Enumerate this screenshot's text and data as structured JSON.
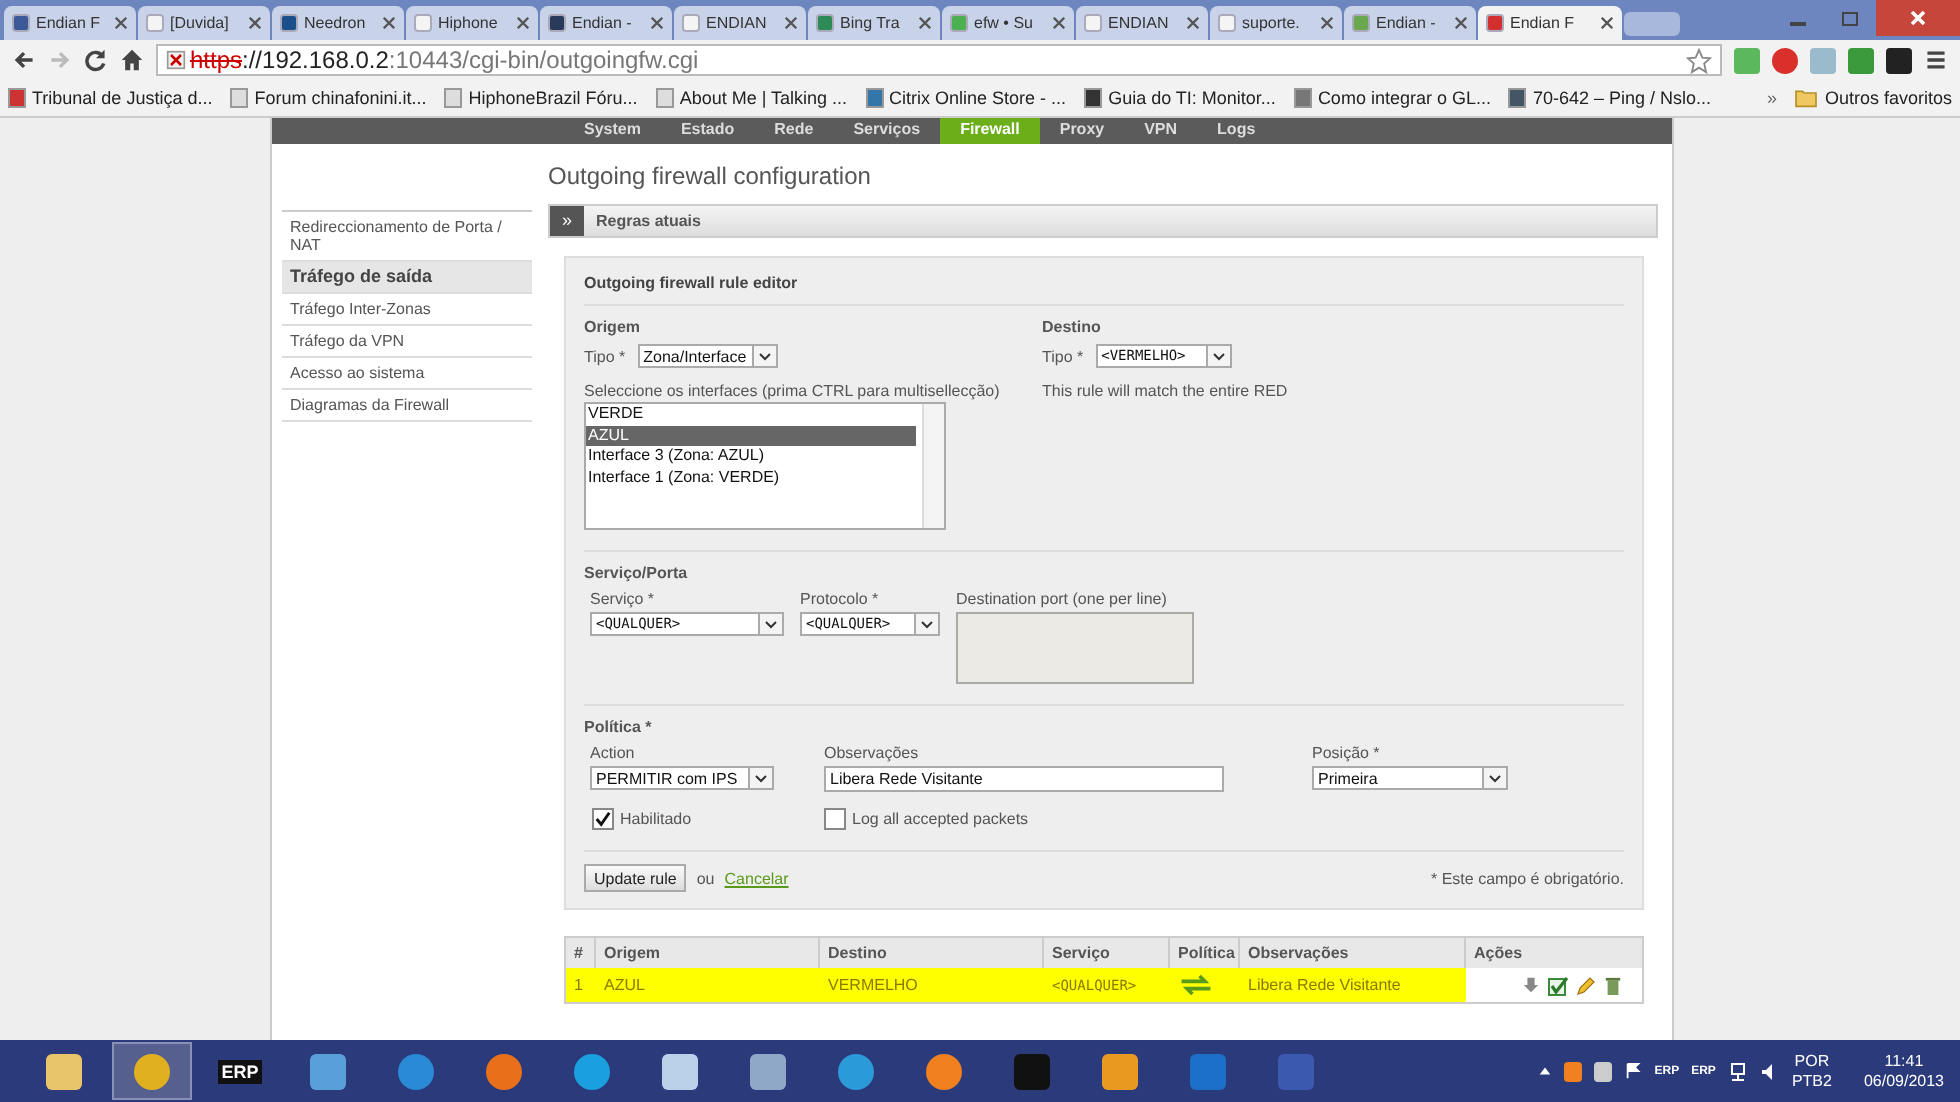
{
  "browser": {
    "tabs": [
      {
        "title": "Endian F",
        "kind": "facebook",
        "selected": false
      },
      {
        "title": "[Duvida]",
        "kind": "page",
        "selected": false
      },
      {
        "title": "Needron",
        "kind": "arch",
        "selected": false
      },
      {
        "title": "Hiphone",
        "kind": "page",
        "selected": false
      },
      {
        "title": "Endian -",
        "kind": "e",
        "selected": false
      },
      {
        "title": "ENDIAN",
        "kind": "page",
        "selected": false
      },
      {
        "title": "Bing Tra",
        "kind": "bing",
        "selected": false
      },
      {
        "title": "efw • Su",
        "kind": "green",
        "selected": false
      },
      {
        "title": "ENDIAN",
        "kind": "page",
        "selected": false
      },
      {
        "title": "suporte.",
        "kind": "page",
        "selected": false
      },
      {
        "title": "Endian -",
        "kind": "leaf",
        "selected": false
      },
      {
        "title": "Endian F",
        "kind": "stop",
        "selected": true
      }
    ],
    "url": {
      "scheme": "https",
      "host": "://192.168.0.2",
      "rest": ":10443/cgi-bin/outgoingfw.cgi"
    },
    "bookmarks": [
      {
        "title": "Tribunal de Justiça d...",
        "kind": "triangle"
      },
      {
        "title": "Forum chinafonini.it...",
        "kind": "page"
      },
      {
        "title": "HiphoneBrazil Fóru...",
        "kind": "page"
      },
      {
        "title": "About Me | Talking ...",
        "kind": "page"
      },
      {
        "title": "Citrix Online Store - ...",
        "kind": "dots"
      },
      {
        "title": "Guia do TI: Monitor...",
        "kind": "person"
      },
      {
        "title": "Como integrar o GL...",
        "kind": "gear"
      },
      {
        "title": "70-642 – Ping / Nslo...",
        "kind": "wp"
      }
    ],
    "overflow": "»",
    "other_bookmarks": "Outros favoritos"
  },
  "nav": [
    {
      "label": "System",
      "selected": false
    },
    {
      "label": "Estado",
      "selected": false
    },
    {
      "label": "Rede",
      "selected": false
    },
    {
      "label": "Serviços",
      "selected": false
    },
    {
      "label": "Firewall",
      "selected": true
    },
    {
      "label": "Proxy",
      "selected": false
    },
    {
      "label": "VPN",
      "selected": false
    },
    {
      "label": "Logs",
      "selected": false
    }
  ],
  "sidebar": [
    {
      "label": "Redireccionamento de Porta / NAT",
      "selected": false
    },
    {
      "label": "Tráfego de saída",
      "selected": true
    },
    {
      "label": "Tráfego Inter-Zonas",
      "selected": false
    },
    {
      "label": "Tráfego da VPN",
      "selected": false
    },
    {
      "label": "Acesso ao sistema",
      "selected": false
    },
    {
      "label": "Diagramas da Firewall",
      "selected": false
    }
  ],
  "page_title": "Outgoing firewall configuration",
  "panel": {
    "toggle": "»",
    "title": "Regras atuais"
  },
  "editor": {
    "title": "Outgoing firewall rule editor",
    "origem": {
      "heading": "Origem",
      "type_label": "Tipo *",
      "type_value": "Zona/Interface",
      "list_label": "Seleccione os interfaces (prima CTRL para multisellecção)",
      "options": [
        {
          "label": "VERDE",
          "selected": false
        },
        {
          "label": "AZUL",
          "selected": true
        },
        {
          "label": "Interface 3 (Zona: AZUL)",
          "selected": false
        },
        {
          "label": "Interface 1 (Zona: VERDE)",
          "selected": false
        }
      ]
    },
    "destino": {
      "heading": "Destino",
      "type_label": "Tipo *",
      "type_value": "<VERMELHO>",
      "note": "This rule will match the entire RED"
    },
    "service": {
      "heading": "Serviço/Porta",
      "service_label": "Serviço *",
      "service_value": "<QUALQUER>",
      "protocol_label": "Protocolo *",
      "protocol_value": "<QUALQUER>",
      "port_label": "Destination port (one per line)"
    },
    "policy": {
      "heading": "Política *",
      "action_label": "Action",
      "action_value": "PERMITIR com IPS",
      "notes_label": "Observações",
      "notes_value": "Libera Rede Visitante",
      "position_label": "Posição *",
      "position_value": "Primeira",
      "checkboxes": [
        {
          "label": "Habilitado",
          "checked": true
        },
        {
          "label": "Log all accepted packets",
          "checked": false
        }
      ]
    },
    "update_button": "Update rule",
    "or": "ou",
    "cancel": "Cancelar",
    "required_note": "* Este campo é obrigatório."
  },
  "table": {
    "columns": [
      "#",
      "Origem",
      "Destino",
      "Serviço",
      "Política",
      "Observações",
      "Ações"
    ],
    "rows": [
      {
        "cells": [
          "1",
          "AZUL",
          "VERMELHO",
          "<QUALQUER>",
          "",
          "Libera Rede Visitante",
          ""
        ],
        "highlighted": true
      }
    ]
  },
  "taskbar": {
    "apps": [
      {
        "kind": "folder",
        "active": false
      },
      {
        "kind": "chrome",
        "active": true
      },
      {
        "kind": "erp",
        "label": "ERP",
        "active": false
      },
      {
        "kind": "network",
        "active": false
      },
      {
        "kind": "ie",
        "active": false
      },
      {
        "kind": "firefox",
        "active": false
      },
      {
        "kind": "skype",
        "active": false
      },
      {
        "kind": "notepad",
        "active": false
      },
      {
        "kind": "calculator",
        "active": false
      },
      {
        "kind": "sync",
        "active": false
      },
      {
        "kind": "flame",
        "active": false
      },
      {
        "kind": "terminal",
        "active": false
      },
      {
        "kind": "outlook",
        "active": false
      },
      {
        "kind": "teamviewer",
        "active": false
      },
      {
        "kind": "remote",
        "active": false
      }
    ],
    "tray_labels": [
      "ERP",
      "ERP"
    ],
    "language": "POR",
    "layout": "PTB2",
    "time": "11:41",
    "date": "06/09/2013"
  }
}
